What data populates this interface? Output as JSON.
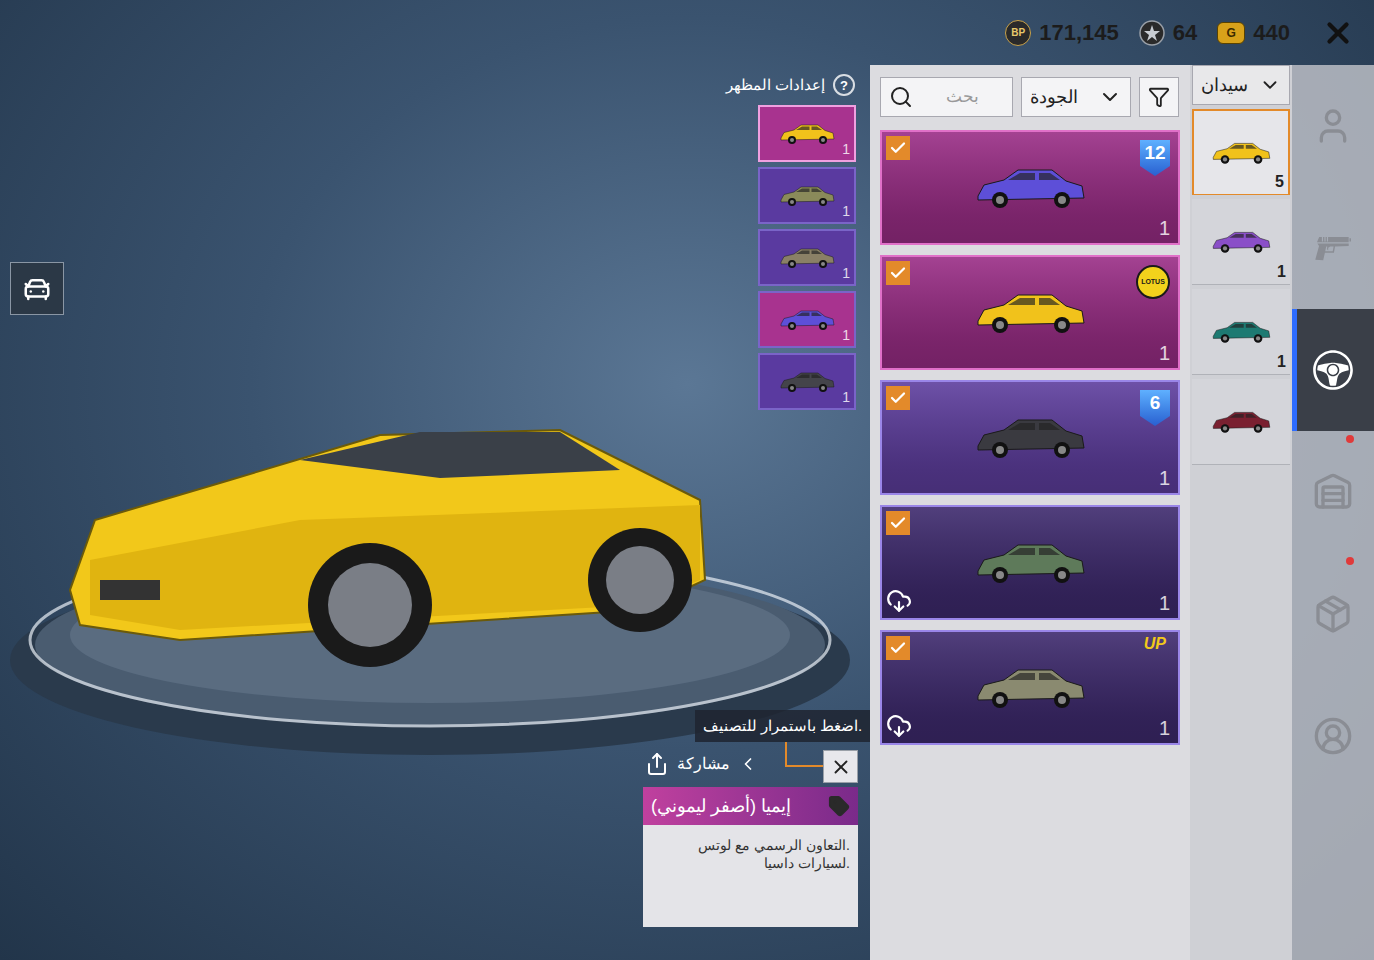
{
  "currencies": [
    {
      "symbol": "BP",
      "amount": "171,145"
    },
    {
      "symbol": "",
      "amount": "64"
    },
    {
      "symbol": "G",
      "amount": "440"
    }
  ],
  "appearance_settings": {
    "label": "إعدادات المظهر",
    "help": "?"
  },
  "preview_thumbnails": [
    {
      "count": "1",
      "selected": true,
      "color": "#a8338f",
      "car_color": "#f1c21b"
    },
    {
      "count": "1",
      "selected": false,
      "color": "#5a3aa0",
      "car_color": "#8a8a5a"
    },
    {
      "count": "1",
      "selected": false,
      "color": "#5a3aa0",
      "car_color": "#8a8066"
    },
    {
      "count": "1",
      "selected": false,
      "color": "#a8338f",
      "car_color": "#5d4fd8"
    },
    {
      "count": "1",
      "selected": false,
      "color": "#5a3aa0",
      "car_color": "#44444a"
    }
  ],
  "search": {
    "placeholder": "بحث"
  },
  "sort": {
    "label": "الجودة"
  },
  "category_dropdown": {
    "label": "سيدان"
  },
  "skins": [
    {
      "count": "1",
      "checked": true,
      "badge": "12",
      "badge_kind": "shield",
      "downloadable": false,
      "color": "#9a2d86",
      "border_color": "#e070c8",
      "car_color": "#5d4fd8"
    },
    {
      "count": "1",
      "checked": true,
      "badge": "LOTUS",
      "badge_kind": "lotus",
      "downloadable": false,
      "color": "#9a2d86",
      "border_color": "#e070c8",
      "car_color": "#f1c21b"
    },
    {
      "count": "1",
      "checked": true,
      "badge": "6",
      "badge_kind": "shield",
      "downloadable": false,
      "color": "#5e3e9e",
      "border_color": "#9a86e8",
      "car_color": "#3a3a40"
    },
    {
      "count": "1",
      "checked": true,
      "badge": "",
      "badge_kind": "none",
      "downloadable": true,
      "color": "#3e2a6e",
      "border_color": "#9a86e8",
      "car_color": "#5e7a5a"
    },
    {
      "count": "1",
      "checked": true,
      "badge": "UP",
      "badge_kind": "text",
      "downloadable": true,
      "color": "#3e2a6e",
      "border_color": "#9a86e8",
      "car_color": "#8a8a70"
    }
  ],
  "vehicle_types": [
    {
      "count": "5",
      "selected": true,
      "car_color": "#f1c21b"
    },
    {
      "count": "1",
      "selected": false,
      "car_color": "#8a4fc8"
    },
    {
      "count": "1",
      "selected": false,
      "car_color": "#1d7a72"
    },
    {
      "count": "",
      "selected": false,
      "car_color": "#7a2030"
    }
  ],
  "nav": [
    {
      "kind": "character",
      "selected": false,
      "alert": false
    },
    {
      "kind": "weapon",
      "selected": false,
      "alert": false
    },
    {
      "kind": "vehicle",
      "selected": true,
      "alert": false
    },
    {
      "kind": "building",
      "selected": false,
      "alert": true
    },
    {
      "kind": "box",
      "selected": false,
      "alert": true
    },
    {
      "kind": "outfit",
      "selected": false,
      "alert": false
    }
  ],
  "tooltip": {
    "text": "اضغط باستمرار للتصنيف."
  },
  "share": {
    "label": "مشاركة"
  },
  "item": {
    "name": "إيميا (أصفر ليموني)",
    "description": [
      "التعاون الرسمي مع لوتس.",
      "لسيارات داسيا."
    ]
  }
}
